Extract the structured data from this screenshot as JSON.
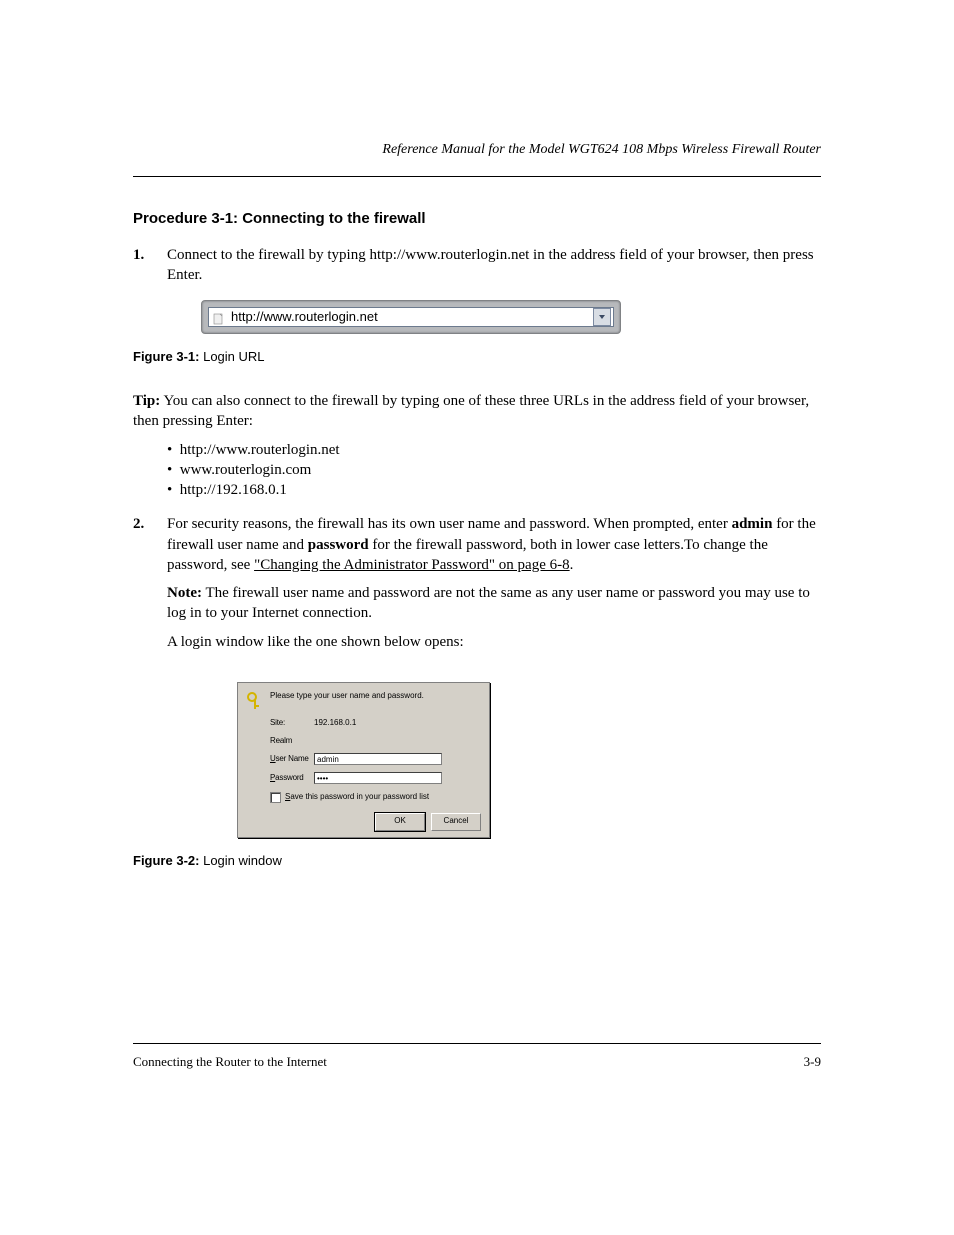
{
  "header": {
    "doc_title": "Reference Manual for the Model WGT624 108 Mbps Wireless Firewall Router"
  },
  "proc": {
    "title": "Procedure 3-1:   Connecting to the firewall",
    "steps": [
      "Connect to the firewall by typing http://www.routerlogin.net in the address field of your browser, then press Enter.",
      "",
      "For security reasons, the firewall has its own user name and password. When prompted, enter admin for the firewall user name and password for the firewall password, both in lower case letters.To change the password, see \"Changing the Administrator Password\" on page 6-8."
    ]
  },
  "tip": "You can also connect to the firewall by typing one of these three URLs in the address field of your browser, then pressing Enter:",
  "tip_urls": [
    "http://www.routerlogin.net",
    "www.routerlogin.com",
    "http://192.168.0.1"
  ],
  "note": "The firewall user name and password are not the same as any user name or password you may use to log in to your Internet connection.",
  "note_followup": "A login window like the one shown below opens:",
  "figures": {
    "addr": {
      "url_text": "http://www.routerlogin.net",
      "caption_num": "Figure 3-1:",
      "caption_text": "Login URL"
    },
    "login": {
      "prompt": "Please type your user name and password.",
      "site_label": "Site:",
      "site_value": "192.168.0.1",
      "realm_label": "Realm",
      "user_label": "User Name",
      "user_value": "admin",
      "pass_label": "Password",
      "pass_value": "xxxx",
      "save_label": "Save this password in your password list",
      "ok_label": "OK",
      "cancel_label": "Cancel",
      "caption_num": "Figure 3-2:",
      "caption_text": "Login window"
    }
  },
  "footer": {
    "left": "Connecting the Router to the Internet",
    "right": "3-9"
  }
}
